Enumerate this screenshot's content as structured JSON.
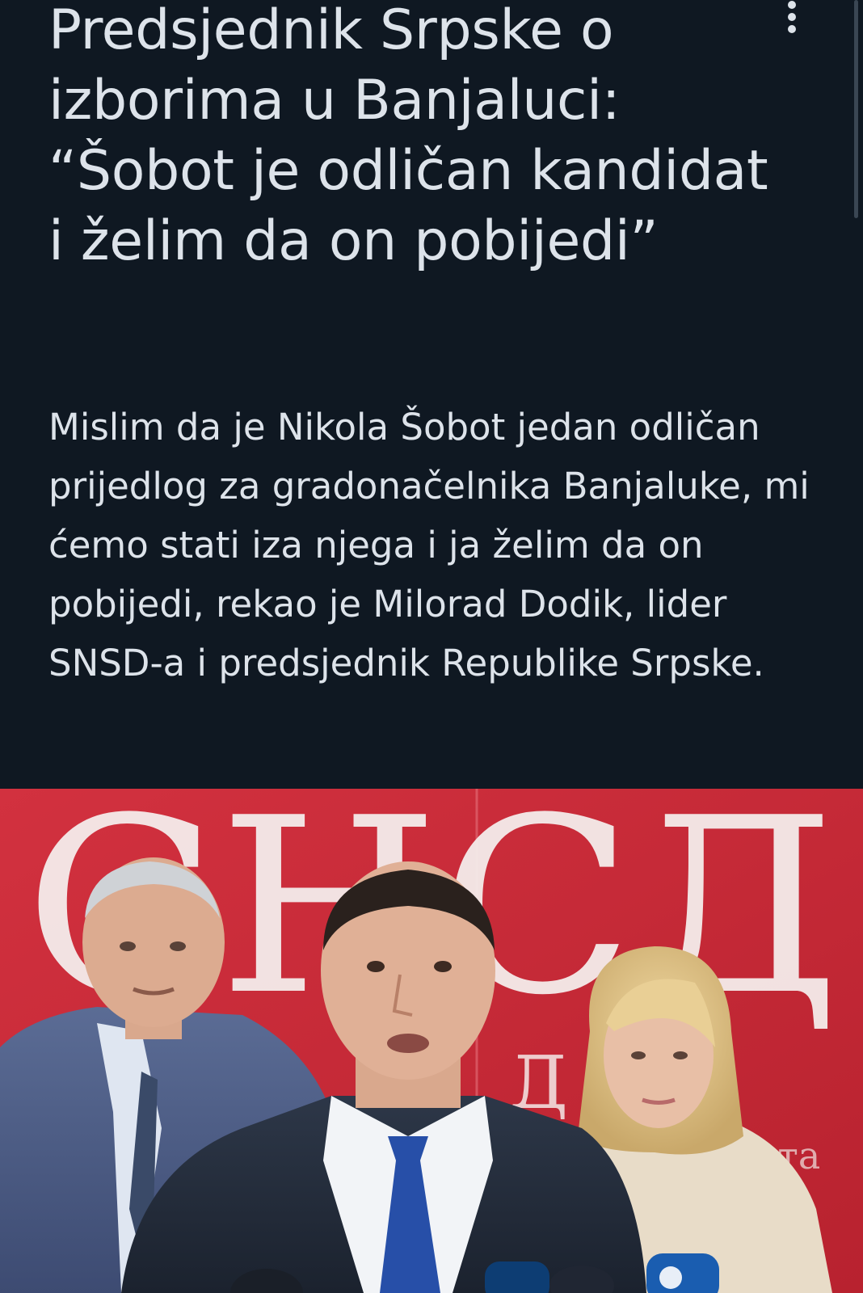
{
  "article": {
    "headline": "Predsjednik Srpske o izborima u Banjaluci: “Šobot je odličan kandidat i želim da on pobijedi”",
    "lead": "Mislim da je Nikola Šobot jedan odličan prijedlog za gradonačelnika Banjaluke, mi ćemo stati iza njega i ja želim da on pobijedi, rekao je Milorad Dodik, lider SNSD-a i predsjednik Republike Srpske."
  },
  "toolbar": {
    "more_icon": "more-vertical-icon"
  },
  "photo": {
    "backdrop_logo": "СНСД",
    "backdrop_text_1": "Д    ИК",
    "backdrop_text_2": "ата"
  },
  "colors": {
    "background": "#0f1822",
    "text": "#dde3ea",
    "banner_red": "#c8283a"
  }
}
